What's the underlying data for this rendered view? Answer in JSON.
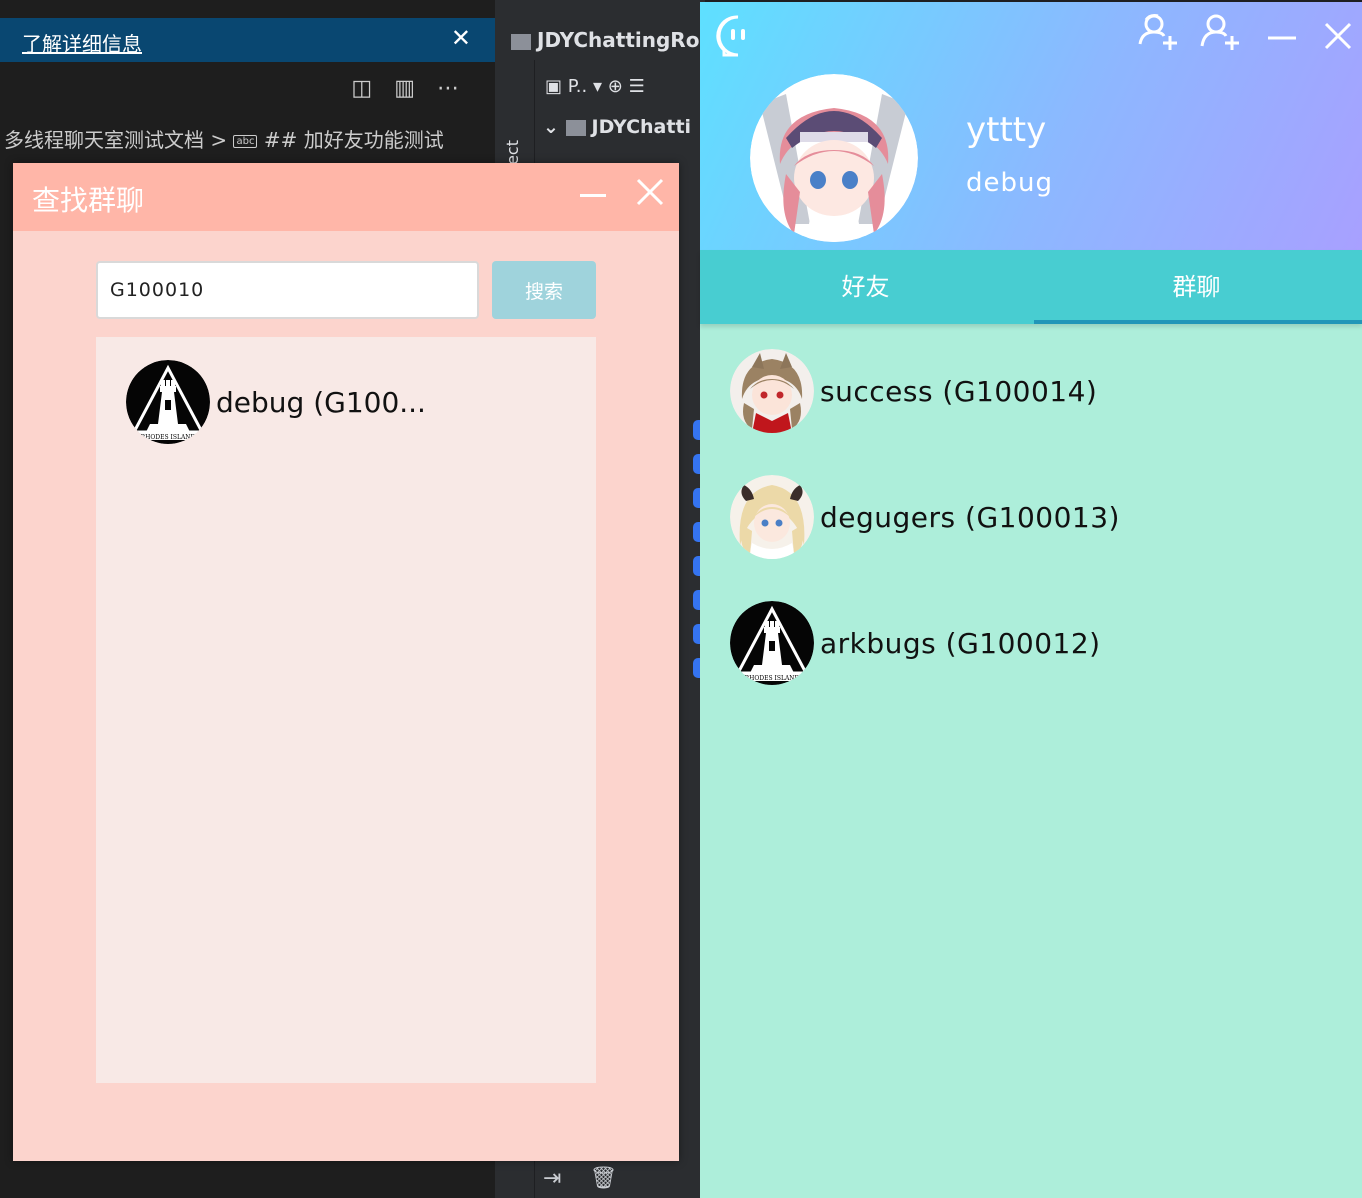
{
  "vscode": {
    "notice_link": "了解详细信息",
    "breadcrumb_doc": "多线程聊天室测试文档",
    "breadcrumb_sep": ">",
    "breadcrumb_abc": "abc",
    "breadcrumb_heading": "## 加好友功能测试"
  },
  "idea": {
    "project_title": "JDYChattingRoo",
    "project_tab": "Project",
    "view_selector": "P..",
    "tree_root": "JDYChatti"
  },
  "find_window": {
    "title": "查找群聊",
    "search_value": "G100010",
    "search_button": "搜索",
    "results": [
      {
        "name": "debug (G100...",
        "avatar": "rhodes-island-logo"
      }
    ]
  },
  "main_window": {
    "user": {
      "name": "yttty",
      "signature": "debug"
    },
    "tabs": [
      {
        "label": "好友",
        "active": false
      },
      {
        "label": "群聊",
        "active": true
      }
    ],
    "groups": [
      {
        "name": "success (G100014)",
        "avatar": "anime-girl-brown"
      },
      {
        "name": "degugers (G100013)",
        "avatar": "anime-girl-blonde"
      },
      {
        "name": "arkbugs (G100012)",
        "avatar": "rhodes-island-logo"
      }
    ]
  },
  "colors": {
    "find_titlebar": "#ffb6a8",
    "find_body": "#fcd4cd",
    "main_header_start": "#5ee0ff",
    "main_header_end": "#a8a0ff",
    "tabs_bg": "#48cdd1",
    "list_bg": "#adeeda"
  }
}
